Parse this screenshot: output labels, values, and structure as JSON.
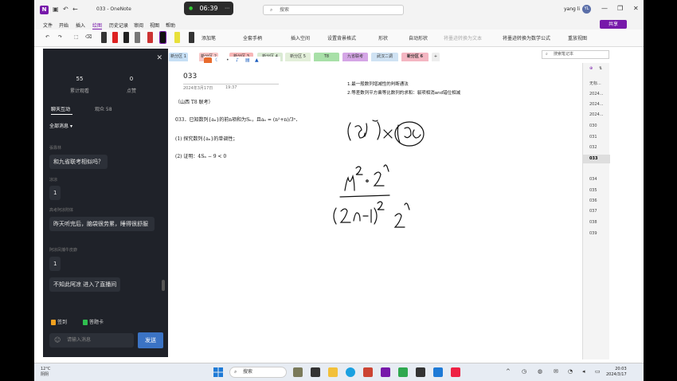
{
  "window": {
    "title": "033 - OneNote",
    "timer": "06:39"
  },
  "search": {
    "placeholder": "搜索"
  },
  "user": {
    "name": "yang li",
    "initials": "YL"
  },
  "menu": [
    "文件",
    "开始",
    "插入",
    "绘图",
    "历史记录",
    "审阅",
    "视图",
    "帮助"
  ],
  "menu_active_index": 3,
  "share_label": "共享",
  "ribbon": {
    "add_pen": "添加笔",
    "ruler": "全套手柄",
    "insert_space": "插入空间",
    "background": "设置背景格式",
    "shapes": "形状",
    "auto_shape": "自动形状",
    "ink_to_text": "将墨迹转换为文本",
    "ink_to_math": "将墨迹转换为数学公式",
    "replay": "重放视图"
  },
  "section_tabs": [
    {
      "label": "新分区 1",
      "color": "#c6dff5"
    },
    {
      "label": "新分区 2",
      "color": "#f7c7c7"
    },
    {
      "label": "新分区 3",
      "color": "#f7b6b6"
    },
    {
      "label": "新分区 4",
      "color": "#d9ead3"
    },
    {
      "label": "新分区 5",
      "color": "#e2efd9"
    },
    {
      "label": "T8",
      "color": "#a8e0a8"
    },
    {
      "label": "九省联考",
      "color": "#d5a6e6"
    },
    {
      "label": "武汉二调",
      "color": "#cfe2f3"
    },
    {
      "label": "新分区 6",
      "color": "#f4b6c2"
    }
  ],
  "notebook_search": "搜索笔记本",
  "page": {
    "title": "033",
    "date": "2024年3月17日",
    "time": "19:37",
    "source": "（山西 T8 联考）",
    "question": "033．已知数列{aₙ}的前n项和为Sₙ，且aₙ = (n²+n)/3ⁿ．",
    "part1": "(1) 探究数列{aₙ}的单调性；",
    "part2": "(2) 证明：4Sₙ − 9 < 0",
    "note1": "1.最一般数列增减性的判断通法",
    "note2": "2.等差数列平方乘等比数列的求和：裂项相消and错位相减"
  },
  "page_list": [
    "无标...",
    "2024...",
    "2024...",
    "2024...",
    "030",
    "031",
    "032",
    "033",
    "034",
    "035",
    "036",
    "037",
    "038",
    "039"
  ],
  "page_list_selected": 7,
  "chat": {
    "stats": [
      {
        "num": "55",
        "label": "累计观看"
      },
      {
        "num": "0",
        "label": "点赞"
      }
    ],
    "tabs": [
      "聊天互动",
      "观众 58"
    ],
    "filter": "全部消息",
    "messages": [
      {
        "name": "張靠林",
        "text": "和九省联考相似吗？"
      },
      {
        "name": "凉凉",
        "text": "1"
      },
      {
        "name": "高考阿凉附体",
        "text": "昨天听完后，脑袋很劳累，睡得很舒服"
      },
      {
        "name": "阿凉凤捕牛皮癖",
        "text": "1"
      },
      {
        "name": "",
        "text": "不知此阿凉 进入了直播间"
      }
    ],
    "chips": [
      "签到",
      "答题卡"
    ],
    "input_placeholder": "请输入消息",
    "send": "发送"
  },
  "taskbar": {
    "weather_temp": "12°C",
    "weather_desc": "阴阴",
    "search": "搜索",
    "time": "20:03",
    "date": "2024/3/17"
  }
}
